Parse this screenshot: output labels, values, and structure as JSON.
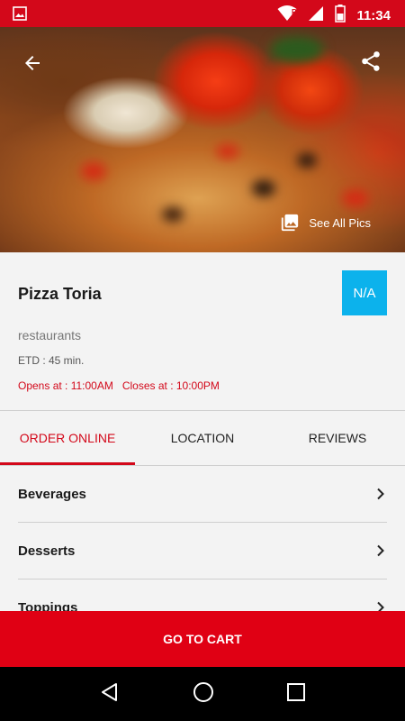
{
  "status_bar": {
    "time": "11:34",
    "icons": [
      "image-icon",
      "wifi-icon",
      "signal-icon",
      "battery-icon"
    ]
  },
  "hero": {
    "see_all_label": "See All Pics"
  },
  "restaurant": {
    "name": "Pizza Toria",
    "rating": "N/A",
    "category": "restaurants",
    "etd": "ETD : 45 min.",
    "opens": "Opens at : 11:00AM",
    "closes": "Closes at : 10:00PM"
  },
  "tabs": [
    {
      "label": "ORDER ONLINE",
      "active": true
    },
    {
      "label": "LOCATION",
      "active": false
    },
    {
      "label": "REVIEWS",
      "active": false
    }
  ],
  "menu": [
    {
      "label": "Beverages"
    },
    {
      "label": "Desserts"
    },
    {
      "label": "Toppings"
    }
  ],
  "cart_button": "GO TO CART",
  "colors": {
    "primary": "#e00014",
    "rating_badge": "#0cb2ec"
  }
}
